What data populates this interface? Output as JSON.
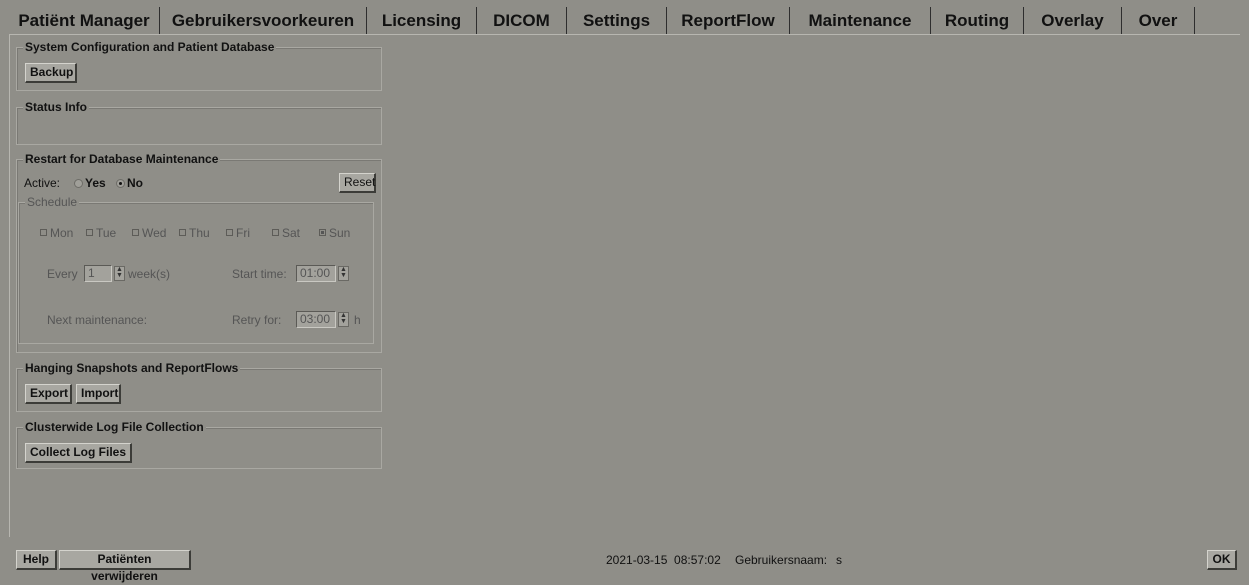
{
  "tabs": [
    {
      "label": "Patiënt Manager",
      "active": false
    },
    {
      "label": "Gebruikersvoorkeuren",
      "active": false
    },
    {
      "label": "Licensing",
      "active": false
    },
    {
      "label": "DICOM",
      "active": false
    },
    {
      "label": "Settings",
      "active": false
    },
    {
      "label": "ReportFlow",
      "active": false
    },
    {
      "label": "Maintenance",
      "active": true
    },
    {
      "label": "Routing",
      "active": false
    },
    {
      "label": "Overlay",
      "active": false
    },
    {
      "label": "Over",
      "active": false
    }
  ],
  "backup": {
    "title": "System Configuration and Patient Database",
    "button": "Backup"
  },
  "status_info": {
    "title": "Status Info"
  },
  "restart": {
    "title": "Restart for Database Maintenance",
    "active_label": "Active:",
    "yes": "Yes",
    "no": "No",
    "selected": "No",
    "reset": "Reset",
    "schedule": {
      "title": "Schedule",
      "days": [
        {
          "label": "Mon",
          "checked": false
        },
        {
          "label": "Tue",
          "checked": false
        },
        {
          "label": "Wed",
          "checked": false
        },
        {
          "label": "Thu",
          "checked": false
        },
        {
          "label": "Fri",
          "checked": false
        },
        {
          "label": "Sat",
          "checked": false
        },
        {
          "label": "Sun",
          "checked": true
        }
      ],
      "every_label": "Every",
      "every_value": "1",
      "every_unit": "week(s)",
      "start_label": "Start time:",
      "start_value": "01:00",
      "next_label": "Next maintenance:",
      "retry_label": "Retry for:",
      "retry_value": "03:00",
      "retry_unit": "h"
    }
  },
  "hanging": {
    "title": "Hanging Snapshots and ReportFlows",
    "export": "Export",
    "import": "Import"
  },
  "logs": {
    "title": "Clusterwide Log File Collection",
    "button": "Collect Log Files"
  },
  "statusbar": {
    "help": "Help",
    "delete_patients": "Patiënten verwijderen",
    "datetime": "2021-03-15  08:57:02",
    "user_label": "Gebruikersnaam:",
    "user": "s",
    "ok": "OK"
  }
}
